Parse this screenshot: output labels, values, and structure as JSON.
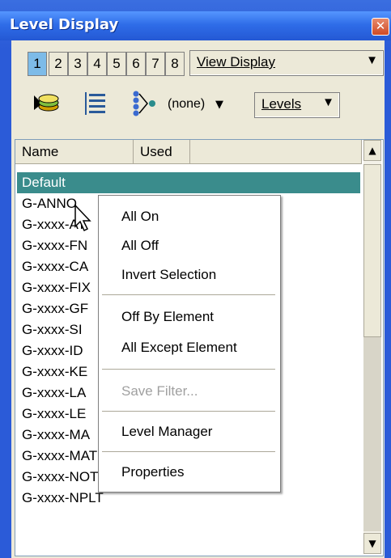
{
  "window": {
    "title": "Level Display",
    "close_glyph": "✕"
  },
  "toolbar": {
    "view_numbers": [
      "1",
      "2",
      "3",
      "4",
      "5",
      "6",
      "7",
      "8"
    ],
    "active_view": "1",
    "view_display_label": "View Display",
    "filter_value": "(none)",
    "levels_label": "Levels",
    "icons": [
      "level-symbology-icon",
      "level-list-icon",
      "level-filter-icon"
    ]
  },
  "list": {
    "columns": [
      "Name",
      "Used"
    ],
    "rows": [
      "Default",
      "G-ANNO",
      "G-xxxx-AT",
      "G-xxxx-FN",
      "G-xxxx-CA",
      "G-xxxx-FIX",
      "G-xxxx-GF",
      "G-xxxx-SI",
      "G-xxxx-ID",
      "G-xxxx-KE",
      "G-xxxx-LA",
      "G-xxxx-LE",
      "G-xxxx-MA",
      "G-xxxx-MATC",
      "G-xxxx-NOTE",
      "G-xxxx-NPLT"
    ],
    "selected_row": "Default"
  },
  "context_menu": {
    "all_on": "All On",
    "all_off": "All Off",
    "invert_selection": "Invert Selection",
    "off_by_element": "Off By Element",
    "all_except_element": "All Except Element",
    "save_filter": "Save Filter...",
    "level_manager": "Level Manager",
    "properties": "Properties"
  },
  "colors": {
    "titlebar": "#2f6de8",
    "selection": "#3a8c8c",
    "active_tab": "#7dbbe8"
  }
}
